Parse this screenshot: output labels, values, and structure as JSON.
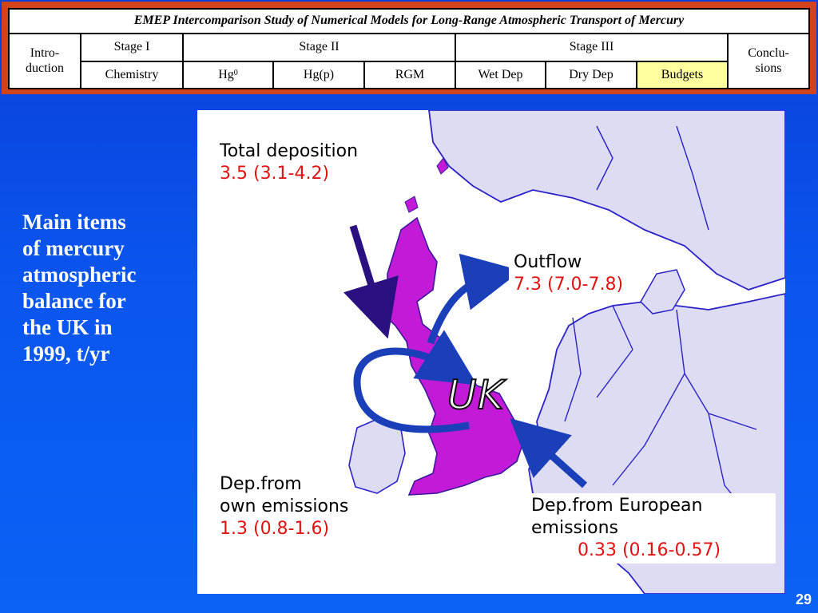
{
  "nav": {
    "title": "EMEP Intercomparison Study of Numerical Models for Long-Range Atmospheric Transport of Mercury",
    "introduction": "Intro-duction",
    "intro_line1": "Intro-",
    "intro_line2": "duction",
    "stage1": "Stage I",
    "stage2": "Stage II",
    "stage3": "Stage III",
    "conclusions_line1": "Conclu-",
    "conclusions_line2": "sions",
    "chemistry": "Chemistry",
    "hg0": "Hg",
    "hg0_sup": "0",
    "hgp": "Hg(p)",
    "rgm": "RGM",
    "wet_dep": "Wet Dep",
    "dry_dep": "Dry Dep",
    "budgets": "Budgets"
  },
  "main_text": {
    "line1": "Main items",
    "line2": "of mercury",
    "line3": "atmospheric",
    "line4": "balance for",
    "line5": "the UK in",
    "line6": "1999, t/yr"
  },
  "map": {
    "total_deposition_label": "Total deposition",
    "total_deposition_value": "3.5 (3.1-4.2)",
    "outflow_label": "Outflow",
    "outflow_value": "7.3 (7.0-7.8)",
    "own_label_line1": "Dep.from",
    "own_label_line2": "own emissions",
    "own_value": "1.3 (0.8-1.6)",
    "european_label_line1": "Dep.from European",
    "european_label_line2": "emissions",
    "european_value": "0.33 (0.16-0.57)",
    "country_label": "UK",
    "colors": {
      "land": "#dedcf2",
      "sea": "#ffffff",
      "uk": "#c21ad6",
      "border": "#2a22c8",
      "arrow_blue": "#1b3fb8",
      "arrow_dark": "#2a1080",
      "value_red": "#e11212"
    }
  },
  "page_number": "29"
}
